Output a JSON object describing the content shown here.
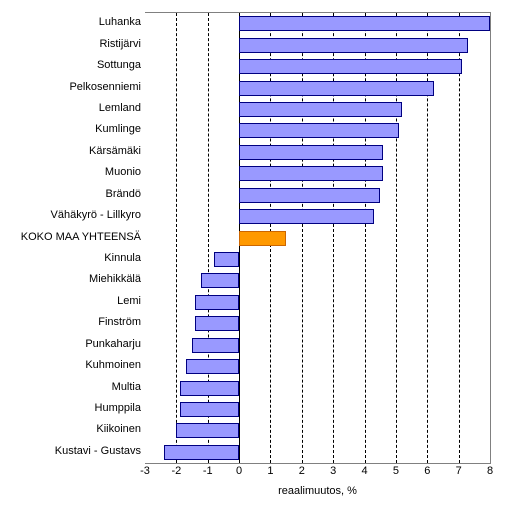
{
  "chart_data": {
    "type": "bar",
    "orientation": "horizontal",
    "xlabel": "reaalimuutos, %",
    "ylabel": "",
    "xlim": [
      -3,
      8
    ],
    "xticks": [
      -3,
      -2,
      -1,
      0,
      1,
      2,
      3,
      4,
      5,
      6,
      7,
      8
    ],
    "categories": [
      "Luhanka",
      "Ristijärvi",
      "Sottunga",
      "Pelkosenniemi",
      "Lemland",
      "Kumlinge",
      "Kärsämäki",
      "Muonio",
      "Brändö",
      "Vähäkyrö - Lillkyro",
      "KOKO MAA YHTEENSÄ",
      "Kinnula",
      "Miehikkälä",
      "Lemi",
      "Finström",
      "Punkaharju",
      "Kuhmoinen",
      "Multia",
      "Humppila",
      "Kiikoinen",
      "Kustavi - Gustavs"
    ],
    "values": [
      8.0,
      7.3,
      7.1,
      6.2,
      5.2,
      5.1,
      4.6,
      4.6,
      4.5,
      4.3,
      1.5,
      -0.8,
      -1.2,
      -1.4,
      -1.4,
      -1.5,
      -1.7,
      -1.9,
      -1.9,
      -2.0,
      -2.4
    ],
    "highlight_index": 10,
    "bar_color": "#9999ff",
    "highlight_color": "#ff9900"
  }
}
